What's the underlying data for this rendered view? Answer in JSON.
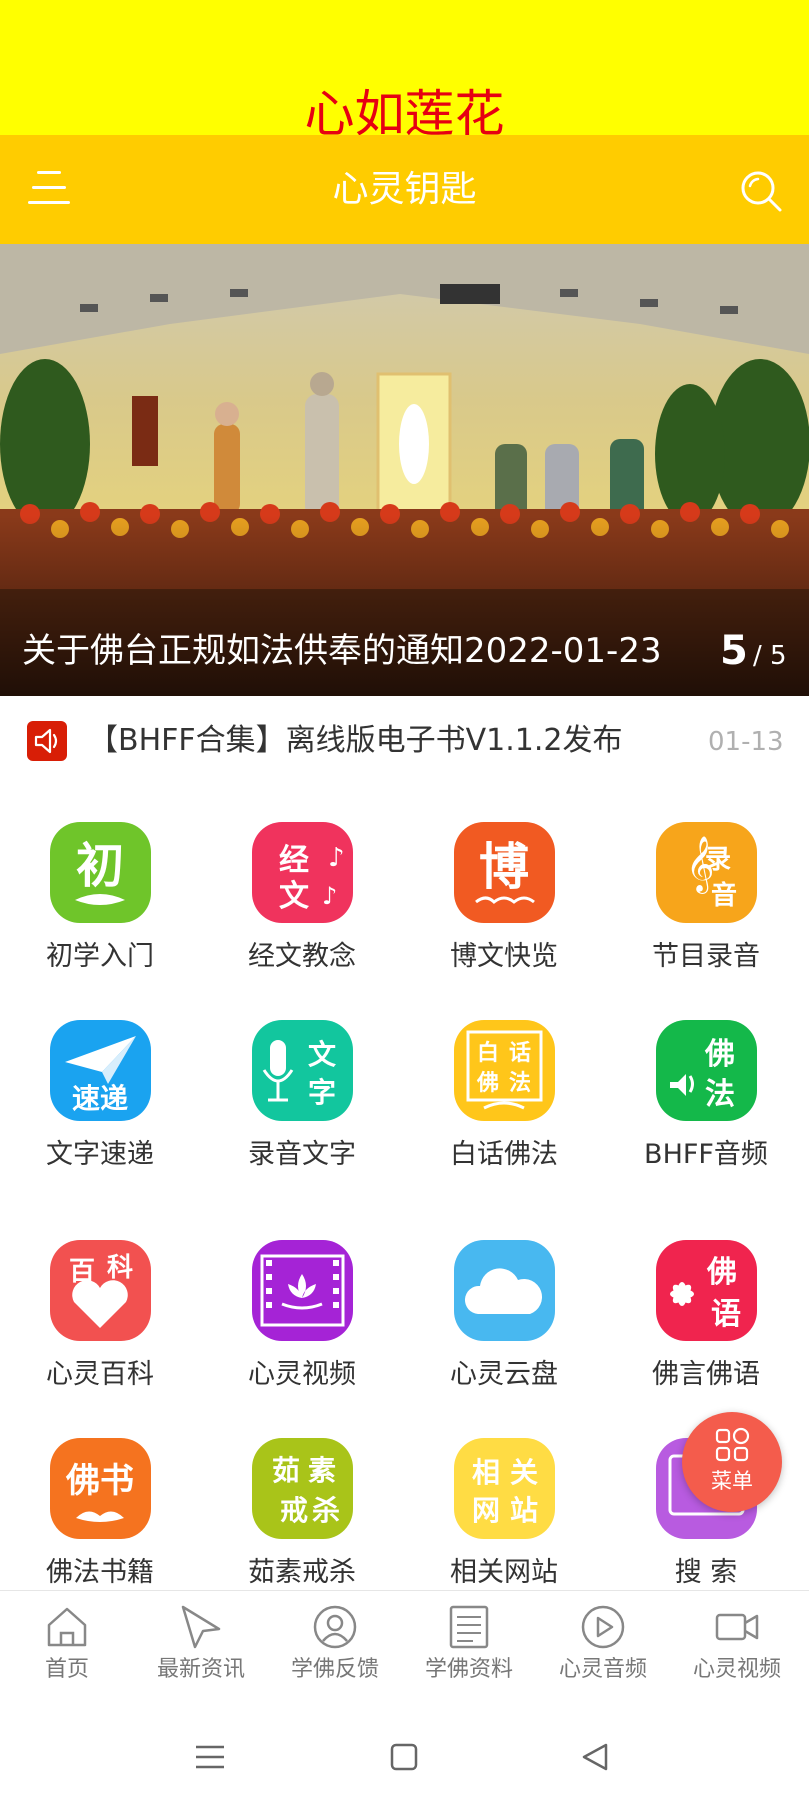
{
  "banner": {
    "title": "心如莲花"
  },
  "header": {
    "title": "心灵钥匙",
    "menu_icon": "menu-icon",
    "search_icon": "search-icon"
  },
  "carousel": {
    "caption": "关于佛台正规如法供奉的通知2022-01-23",
    "current": "5",
    "total": "/ 5"
  },
  "notice": {
    "text": "【BHFF合集】离线版电子书V1.1.2发布",
    "date": "01-13",
    "icon": "speaker-icon"
  },
  "grid": [
    {
      "label": "初学入门",
      "glyph": "初",
      "color": "#6fc52a"
    },
    {
      "label": "经文教念",
      "glyph": "经文",
      "color": "#f0335d"
    },
    {
      "label": "博文快览",
      "glyph": "博",
      "color": "#f15a22"
    },
    {
      "label": "节目录音",
      "glyph": "录音",
      "color": "#f7a51b"
    },
    {
      "label": "文字速递",
      "glyph": "速递",
      "color": "#1aa3f0"
    },
    {
      "label": "录音文字",
      "glyph": "文字",
      "color": "#12c69e"
    },
    {
      "label": "白话佛法",
      "glyph": "白话佛法",
      "color": "#ffc61a"
    },
    {
      "label": "BHFF音频",
      "glyph": "佛法",
      "color": "#14b84a"
    },
    {
      "label": "心灵百科",
      "glyph": "百科",
      "color": "#f25150"
    },
    {
      "label": "心灵视频",
      "glyph": "",
      "color": "#a523d6"
    },
    {
      "label": "心灵云盘",
      "glyph": "",
      "color": "#48b8f0"
    },
    {
      "label": "佛言佛语",
      "glyph": "佛语",
      "color": "#f0244e"
    },
    {
      "label": "佛法书籍",
      "glyph": "佛书",
      "color": "#f5731f"
    },
    {
      "label": "茹素戒杀",
      "glyph": "茹素戒杀",
      "color": "#a9c419"
    },
    {
      "label": "相关网站",
      "glyph": "相关网站",
      "color": "#ffdc44"
    },
    {
      "label": "搜 索",
      "glyph": "",
      "color": "#b85be0"
    }
  ],
  "fab": {
    "label": "菜单",
    "icon": "grid-icon"
  },
  "bottom_nav": [
    {
      "label": "首页",
      "icon": "home-icon"
    },
    {
      "label": "最新资讯",
      "icon": "send-icon"
    },
    {
      "label": "学佛反馈",
      "icon": "user-circle-icon"
    },
    {
      "label": "学佛资料",
      "icon": "document-icon"
    },
    {
      "label": "心灵音频",
      "icon": "play-icon"
    },
    {
      "label": "心灵视频",
      "icon": "video-icon"
    }
  ],
  "colors": {
    "banner": "#ffff00",
    "appbar": "#ffcc00",
    "accent_red": "#e60012"
  }
}
